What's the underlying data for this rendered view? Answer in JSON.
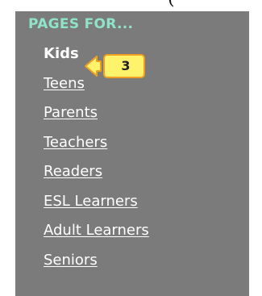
{
  "colors": {
    "panel_bg": "#7b7b7b",
    "heading": "#8ee3c8",
    "link": "#ffffff",
    "callout_fill": "#fff36b",
    "callout_border": "#f0a020"
  },
  "sidebar": {
    "heading": "PAGES FOR...",
    "current_item": "Kids",
    "items": [
      {
        "label": "Teens"
      },
      {
        "label": "Parents"
      },
      {
        "label": "Teachers"
      },
      {
        "label": "Readers"
      },
      {
        "label": "ESL Learners"
      },
      {
        "label": "Adult Learners"
      },
      {
        "label": "Seniors"
      }
    ]
  },
  "callout": {
    "number": "3",
    "icon": "arrow-left-icon"
  }
}
